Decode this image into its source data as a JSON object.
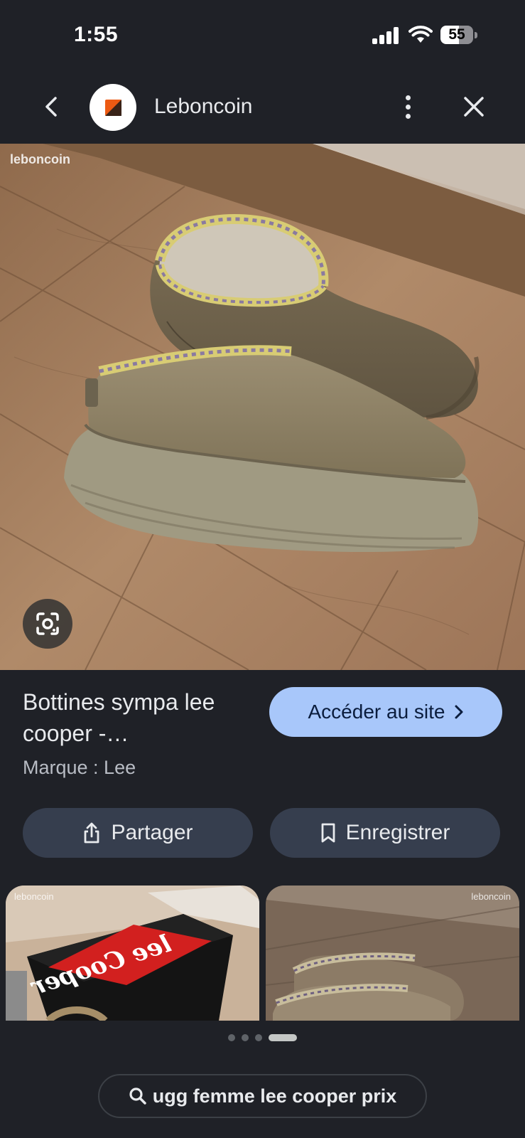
{
  "status_bar": {
    "time": "1:55",
    "battery_level": "55",
    "icons": [
      "signal-icon",
      "wifi-icon",
      "battery-icon"
    ]
  },
  "header": {
    "site_name": "Leboncoin",
    "back_icon": "chevron-left-icon",
    "more_icon": "more-vertical-icon",
    "close_icon": "close-icon"
  },
  "image": {
    "watermark": "leboncoin",
    "lens_icon": "google-lens-icon"
  },
  "result": {
    "title_line1": "Bottines sympa lee",
    "title_line2": "cooper -…",
    "brand": "Marque : Lee",
    "visit_label": "Accéder au site",
    "visit_icon": "chevron-right-icon"
  },
  "actions": {
    "share_label": "Partager",
    "share_icon": "share-icon",
    "save_label": "Enregistrer",
    "save_icon": "bookmark-icon"
  },
  "related": {
    "item1_watermark": "leboncoin",
    "item2_watermark": "leboncoin"
  },
  "pagination": {
    "total": 4,
    "active_index": 3
  },
  "search": {
    "query": "ugg femme lee cooper prix",
    "icon": "search-icon"
  },
  "colors": {
    "background": "#1f2127",
    "visit_button": "#a8c7fa",
    "action_button": "#363e4e",
    "leboncoin_orange": "#ec5a13"
  }
}
